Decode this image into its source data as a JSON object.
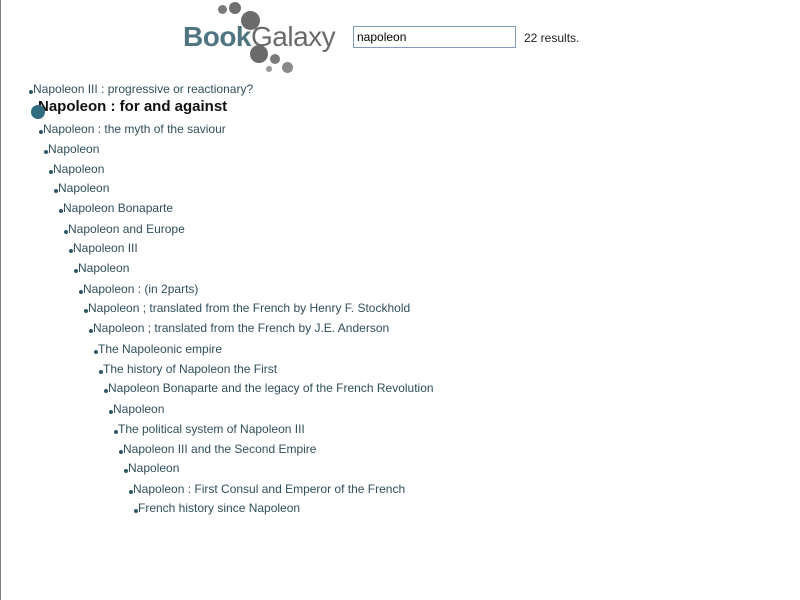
{
  "logo": {
    "part1": "Book",
    "part2": "Galaxy"
  },
  "search": {
    "value": "napoleon",
    "results_label": "22 results."
  },
  "results": [
    {
      "title": "Napoleon III : progressive or reactionary?"
    },
    {
      "title": "Napoleon : for and against",
      "selected": true
    },
    {
      "title": "Napoleon : the myth of the saviour"
    },
    {
      "title": "Napoleon"
    },
    {
      "title": "Napoleon"
    },
    {
      "title": "Napoleon"
    },
    {
      "title": "Napoleon Bonaparte"
    },
    {
      "title": "Napoleon and Europe"
    },
    {
      "title": "Napoleon III"
    },
    {
      "title": "Napoleon"
    },
    {
      "title": "Napoleon : (in 2parts)"
    },
    {
      "title": "Napoleon ; translated from the French by Henry F. Stockhold"
    },
    {
      "title": "Napoleon ; translated from the French by J.E. Anderson"
    },
    {
      "title": "The Napoleonic empire"
    },
    {
      "title": "The history of Napoleon the First"
    },
    {
      "title": "Napoleon Bonaparte and the legacy of the French Revolution"
    },
    {
      "title": "Napoleon"
    },
    {
      "title": "The political system of Napoleon III"
    },
    {
      "title": "Napoleon III and the Second Empire"
    },
    {
      "title": "Napoleon"
    },
    {
      "title": "Napoleon : First Consul and Emperor of the French"
    },
    {
      "title": "French history since Napoleon"
    }
  ],
  "colors": {
    "logo_book": "#4f7580",
    "logo_galaxy": "#6a6a6a",
    "result_text": "#2f4f5b",
    "marker": "#2f5868"
  }
}
